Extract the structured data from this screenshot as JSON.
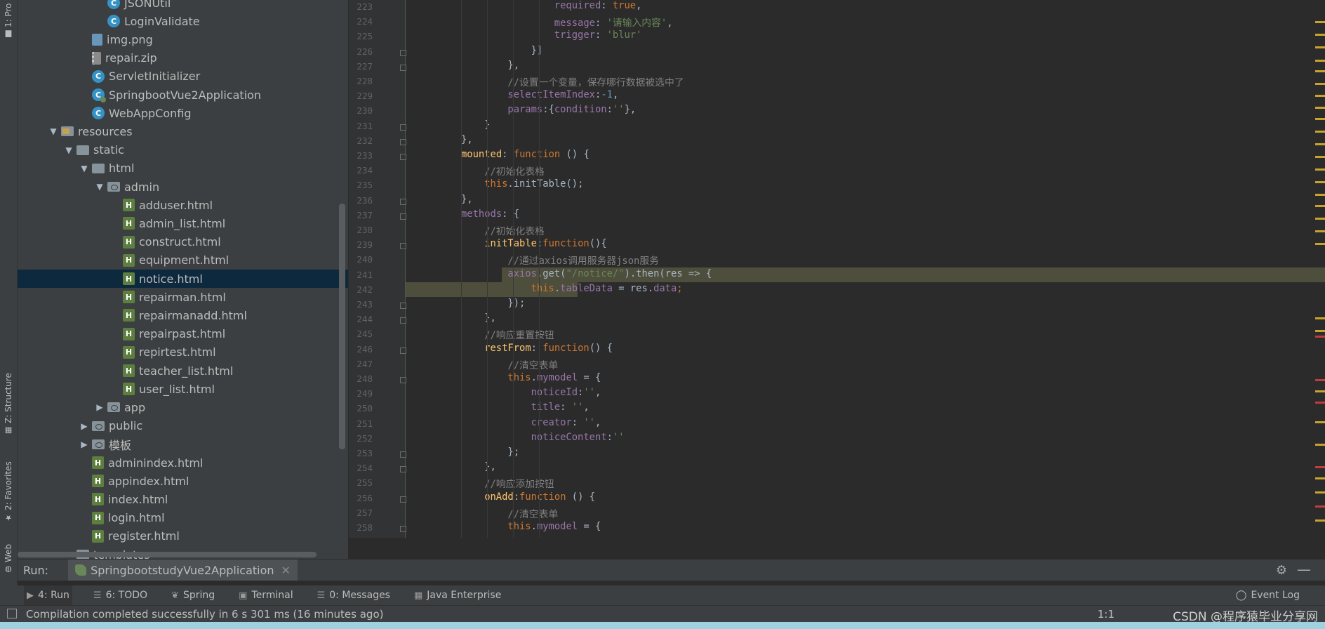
{
  "left_strip": {
    "project_tab": "1: Pro",
    "structure_tab": "Z: Structure",
    "favorites_tab": "2: Favorites",
    "web_tab": "Web"
  },
  "tree": [
    {
      "label": "JSONUtil",
      "icon": "class-icon",
      "indent": 5,
      "arrow": ""
    },
    {
      "label": "LoginValidate",
      "icon": "class-icon",
      "indent": 5,
      "arrow": ""
    },
    {
      "label": "img.png",
      "icon": "image-file-icon",
      "indent": 4,
      "arrow": ""
    },
    {
      "label": "repair.zip",
      "icon": "zip-file-icon",
      "indent": 4,
      "arrow": ""
    },
    {
      "label": "ServletInitializer",
      "icon": "class-icon",
      "indent": 4,
      "arrow": ""
    },
    {
      "label": "SpringbootVue2Application",
      "icon": "spring-class-icon",
      "indent": 4,
      "arrow": ""
    },
    {
      "label": "WebAppConfig",
      "icon": "class-icon",
      "indent": 4,
      "arrow": ""
    },
    {
      "label": "resources",
      "icon": "resources-folder-icon",
      "indent": 2,
      "arrow": "▼"
    },
    {
      "label": "static",
      "icon": "folder-icon",
      "indent": 3,
      "arrow": "▼"
    },
    {
      "label": "html",
      "icon": "folder-icon",
      "indent": 4,
      "arrow": "▼"
    },
    {
      "label": "admin",
      "icon": "web-folder-icon",
      "indent": 5,
      "arrow": "▼"
    },
    {
      "label": "adduser.html",
      "icon": "html-file-icon",
      "indent": 6,
      "arrow": ""
    },
    {
      "label": "admin_list.html",
      "icon": "html-file-icon",
      "indent": 6,
      "arrow": ""
    },
    {
      "label": "construct.html",
      "icon": "html-file-icon",
      "indent": 6,
      "arrow": ""
    },
    {
      "label": "equipment.html",
      "icon": "html-file-icon",
      "indent": 6,
      "arrow": ""
    },
    {
      "label": "notice.html",
      "icon": "html-file-icon",
      "indent": 6,
      "arrow": "",
      "selected": true
    },
    {
      "label": "repairman.html",
      "icon": "html-file-icon",
      "indent": 6,
      "arrow": ""
    },
    {
      "label": "repairmanadd.html",
      "icon": "html-file-icon",
      "indent": 6,
      "arrow": ""
    },
    {
      "label": "repairpast.html",
      "icon": "html-file-icon",
      "indent": 6,
      "arrow": ""
    },
    {
      "label": "repirtest.html",
      "icon": "html-file-icon",
      "indent": 6,
      "arrow": ""
    },
    {
      "label": "teacher_list.html",
      "icon": "html-file-icon",
      "indent": 6,
      "arrow": ""
    },
    {
      "label": "user_list.html",
      "icon": "html-file-icon",
      "indent": 6,
      "arrow": ""
    },
    {
      "label": "app",
      "icon": "web-folder-icon",
      "indent": 5,
      "arrow": "▶"
    },
    {
      "label": "public",
      "icon": "web-folder-icon",
      "indent": 4,
      "arrow": "▶"
    },
    {
      "label": "模板",
      "icon": "web-folder-icon",
      "indent": 4,
      "arrow": "▶"
    },
    {
      "label": "adminindex.html",
      "icon": "html-file-icon",
      "indent": 4,
      "arrow": ""
    },
    {
      "label": "appindex.html",
      "icon": "html-file-icon",
      "indent": 4,
      "arrow": ""
    },
    {
      "label": "index.html",
      "icon": "html-file-icon",
      "indent": 4,
      "arrow": ""
    },
    {
      "label": "login.html",
      "icon": "html-file-icon",
      "indent": 4,
      "arrow": ""
    },
    {
      "label": "register.html",
      "icon": "html-file-icon",
      "indent": 4,
      "arrow": ""
    },
    {
      "label": "templates",
      "icon": "folder-icon",
      "indent": 3,
      "arrow": ""
    }
  ],
  "code_lines": [
    {
      "n": "223",
      "ind": 16,
      "tokens": [
        [
          "prop",
          "required"
        ],
        [
          "",
          ": "
        ],
        [
          "kw",
          "true"
        ],
        [
          "",
          ","
        ]
      ]
    },
    {
      "n": "224",
      "ind": 16,
      "tokens": [
        [
          "prop",
          "message"
        ],
        [
          "",
          ": "
        ],
        [
          "str",
          "'请输入内容'"
        ],
        [
          "",
          ","
        ]
      ]
    },
    {
      "n": "225",
      "ind": 16,
      "tokens": [
        [
          "prop",
          "trigger"
        ],
        [
          "",
          ": "
        ],
        [
          "str",
          "'blur'"
        ]
      ]
    },
    {
      "n": "226",
      "ind": 12,
      "tokens": [
        [
          "",
          "}]"
        ]
      ]
    },
    {
      "n": "227",
      "ind": 8,
      "tokens": [
        [
          "",
          "},"
        ]
      ]
    },
    {
      "n": "228",
      "ind": 8,
      "tokens": [
        [
          "cmt",
          "//设置一个变量，保存哪行数据被选中了"
        ]
      ]
    },
    {
      "n": "229",
      "ind": 8,
      "tokens": [
        [
          "prop",
          "selectItemIndex"
        ],
        [
          "",
          ":"
        ],
        [
          "num",
          "-1"
        ],
        [
          "",
          ","
        ]
      ]
    },
    {
      "n": "230",
      "ind": 8,
      "tokens": [
        [
          "prop",
          "params"
        ],
        [
          "",
          ":{"
        ],
        [
          "prop",
          "condition"
        ],
        [
          "",
          ":"
        ],
        [
          "str",
          "''"
        ],
        [
          "",
          "},"
        ]
      ]
    },
    {
      "n": "231",
      "ind": 4,
      "tokens": [
        [
          "",
          "}"
        ]
      ]
    },
    {
      "n": "232",
      "ind": 0,
      "tokens": [
        [
          "",
          "},"
        ]
      ]
    },
    {
      "n": "233",
      "ind": 0,
      "tokens": [
        [
          "fn",
          "mounted"
        ],
        [
          "",
          ": "
        ],
        [
          "kw",
          "function"
        ],
        [
          "",
          " () {"
        ]
      ]
    },
    {
      "n": "234",
      "ind": 4,
      "tokens": [
        [
          "cmt",
          "//初始化表格"
        ]
      ]
    },
    {
      "n": "235",
      "ind": 4,
      "tokens": [
        [
          "kw",
          "this"
        ],
        [
          "",
          ".initTable();"
        ]
      ]
    },
    {
      "n": "236",
      "ind": 0,
      "tokens": [
        [
          "",
          "},"
        ]
      ]
    },
    {
      "n": "237",
      "ind": 0,
      "tokens": [
        [
          "prop",
          "methods"
        ],
        [
          "",
          ": {"
        ]
      ]
    },
    {
      "n": "238",
      "ind": 4,
      "tokens": [
        [
          "cmt",
          "//初始化表格"
        ]
      ]
    },
    {
      "n": "239",
      "ind": 4,
      "tokens": [
        [
          "fn",
          "initTable"
        ],
        [
          "",
          ":"
        ],
        [
          "kw",
          "function"
        ],
        [
          "",
          "(){"
        ]
      ]
    },
    {
      "n": "240",
      "ind": 8,
      "tokens": [
        [
          "cmt",
          "//通过axios调用服务器json服务"
        ]
      ]
    },
    {
      "n": "241",
      "ind": 8,
      "tokens": [
        [
          "prop",
          "axios"
        ],
        [
          "",
          ".get("
        ],
        [
          "str",
          "\"/notice/\""
        ],
        [
          "",
          ").then(res => {"
        ]
      ],
      "hl": true
    },
    {
      "n": "242",
      "ind": 12,
      "tokens": [
        [
          "kw",
          "this"
        ],
        [
          "",
          "."
        ],
        [
          "prop",
          "tableData"
        ],
        [
          "",
          " = res."
        ],
        [
          "prop",
          "data"
        ],
        [
          "kw",
          ";"
        ]
      ],
      "hl": true
    },
    {
      "n": "243",
      "ind": 8,
      "tokens": [
        [
          "",
          "});"
        ]
      ]
    },
    {
      "n": "244",
      "ind": 4,
      "tokens": [
        [
          "",
          "},"
        ]
      ]
    },
    {
      "n": "245",
      "ind": 4,
      "tokens": [
        [
          "cmt",
          "//响应重置按钮"
        ]
      ]
    },
    {
      "n": "246",
      "ind": 4,
      "tokens": [
        [
          "fn",
          "restFrom"
        ],
        [
          "",
          ": "
        ],
        [
          "kw",
          "function"
        ],
        [
          "",
          "() {"
        ]
      ]
    },
    {
      "n": "247",
      "ind": 8,
      "tokens": [
        [
          "cmt",
          "//清空表单"
        ]
      ]
    },
    {
      "n": "248",
      "ind": 8,
      "tokens": [
        [
          "kw",
          "this"
        ],
        [
          "",
          "."
        ],
        [
          "prop",
          "mymodel"
        ],
        [
          "",
          " = {"
        ]
      ]
    },
    {
      "n": "249",
      "ind": 12,
      "tokens": [
        [
          "prop",
          "noticeId"
        ],
        [
          "",
          ":"
        ],
        [
          "str",
          "''"
        ],
        [
          "",
          ","
        ]
      ]
    },
    {
      "n": "250",
      "ind": 12,
      "tokens": [
        [
          "prop",
          "title"
        ],
        [
          "",
          ": "
        ],
        [
          "str",
          "''"
        ],
        [
          "",
          ","
        ]
      ]
    },
    {
      "n": "251",
      "ind": 12,
      "tokens": [
        [
          "prop",
          "creator"
        ],
        [
          "",
          ": "
        ],
        [
          "str",
          "''"
        ],
        [
          "",
          ","
        ]
      ]
    },
    {
      "n": "252",
      "ind": 12,
      "tokens": [
        [
          "prop",
          "noticeContent"
        ],
        [
          "",
          ":"
        ],
        [
          "str",
          "''"
        ]
      ]
    },
    {
      "n": "253",
      "ind": 8,
      "tokens": [
        [
          "",
          "};"
        ]
      ]
    },
    {
      "n": "254",
      "ind": 4,
      "tokens": [
        [
          "",
          "},"
        ]
      ]
    },
    {
      "n": "255",
      "ind": 4,
      "tokens": [
        [
          "cmt",
          "//响应添加按钮"
        ]
      ]
    },
    {
      "n": "256",
      "ind": 4,
      "tokens": [
        [
          "fn",
          "onAdd"
        ],
        [
          "",
          ":"
        ],
        [
          "kw",
          "function"
        ],
        [
          "",
          " () {"
        ]
      ]
    },
    {
      "n": "257",
      "ind": 8,
      "tokens": [
        [
          "cmt",
          "//清空表单"
        ]
      ]
    },
    {
      "n": "258",
      "ind": 8,
      "tokens": [
        [
          "kw",
          "this"
        ],
        [
          "",
          "."
        ],
        [
          "prop",
          "mymodel"
        ],
        [
          "",
          " = {"
        ]
      ]
    }
  ],
  "browser_icons": [
    {
      "name": "chrome-icon",
      "color": "#db4437",
      "glyph": "◉"
    },
    {
      "name": "firefox-icon",
      "color": "#e66000",
      "glyph": "◉"
    },
    {
      "name": "safari-icon",
      "color": "#1e88e5",
      "glyph": "✦"
    },
    {
      "name": "opera-icon",
      "color": "#cc1b1b",
      "glyph": "O"
    },
    {
      "name": "yandex-icon",
      "color": "#ffffff",
      "glyph": "Y"
    },
    {
      "name": "ie-icon",
      "color": "#1ebbee",
      "glyph": "e"
    },
    {
      "name": "edge-icon",
      "color": "#0078d7",
      "glyph": "e"
    }
  ],
  "run_bar": {
    "label": "Run:",
    "config": "SpringbootstudyVue2Application"
  },
  "tool_windows": [
    {
      "label": "4: Run",
      "icon": "▶",
      "active": true
    },
    {
      "label": "6: TODO",
      "icon": "☰"
    },
    {
      "label": "Spring",
      "icon": "❦"
    },
    {
      "label": "Terminal",
      "icon": "▣"
    },
    {
      "label": "0: Messages",
      "icon": "☰"
    },
    {
      "label": "Java Enterprise",
      "icon": "▦"
    }
  ],
  "event_log": "Event Log",
  "status": {
    "message": "Compilation completed successfully in 6 s 301 ms (16 minutes ago)",
    "position": "1:1",
    "watermark": "CSDN @程序猿毕业分享网"
  },
  "colors": {
    "selection": "#0d293e",
    "highlight": "#4d4e3b",
    "keyword": "#cc7832",
    "string": "#6a8759",
    "comment": "#808080"
  }
}
